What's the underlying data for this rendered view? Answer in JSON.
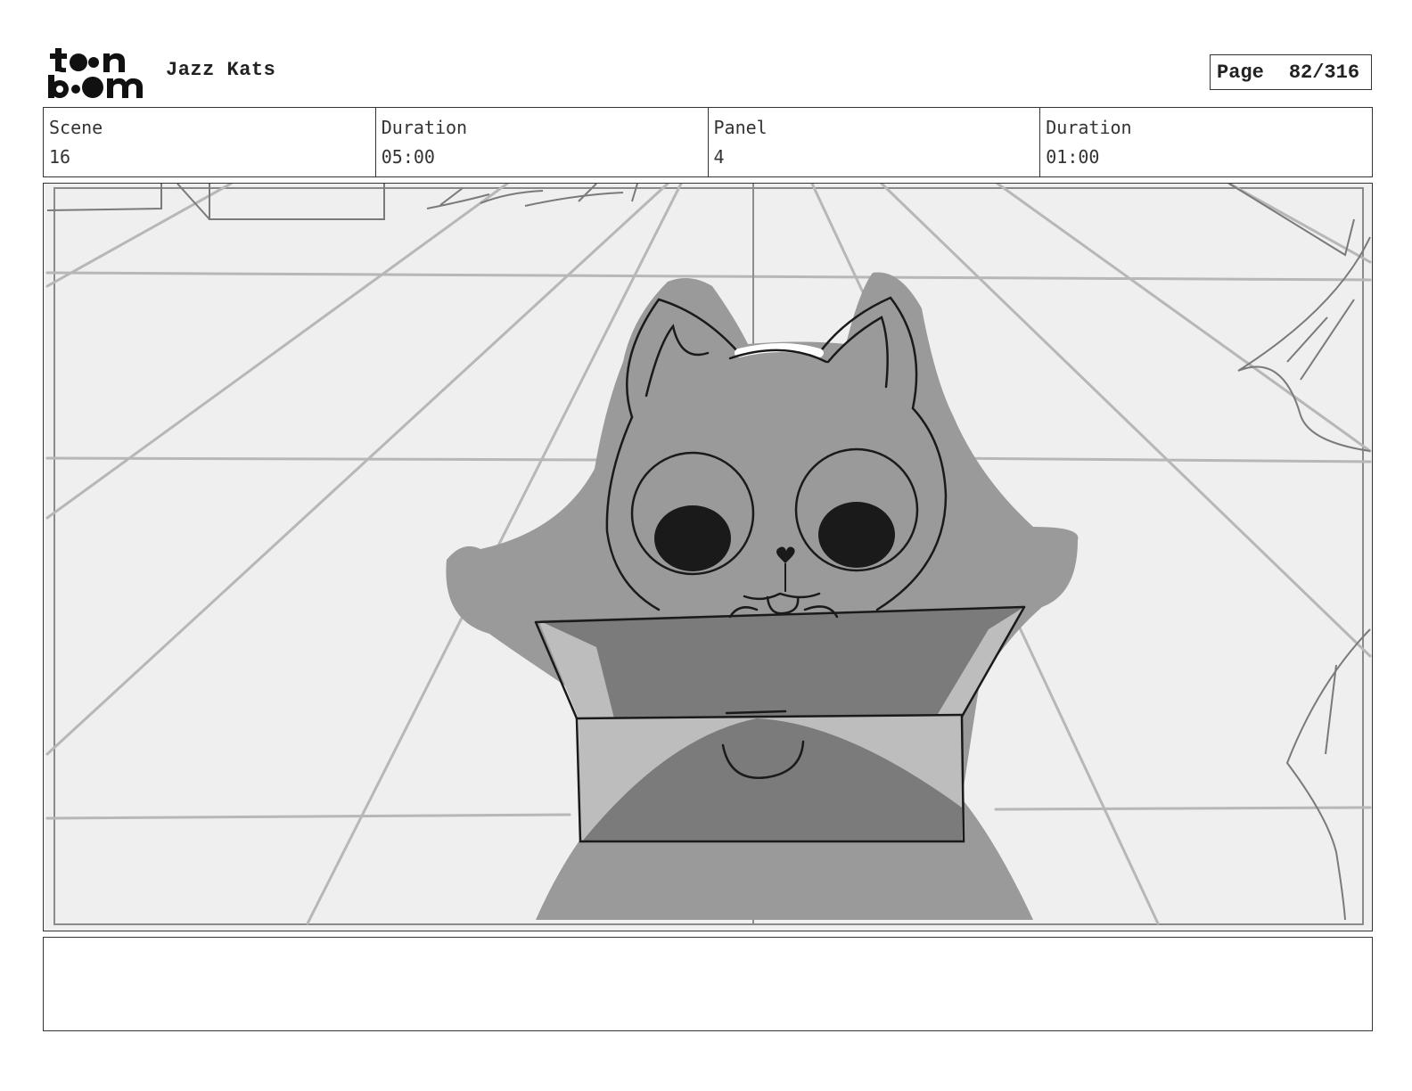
{
  "header": {
    "logo_alt": "toon boom",
    "project_title": "Jazz Kats",
    "page_label": "Page",
    "page_number": "82/316"
  },
  "info": {
    "scene_label": "Scene",
    "scene_value": "16",
    "scene_duration_label": "Duration",
    "scene_duration_value": "05:00",
    "panel_label": "Panel",
    "panel_value": "4",
    "panel_duration_label": "Duration",
    "panel_duration_value": "01:00"
  },
  "notes": {
    "text": ""
  },
  "colors": {
    "frame_border": "#333333",
    "panel_background": "#efefef",
    "cat_fill": "#9a9a9a",
    "box_dark": "#7a7a7a",
    "box_light": "#bdbdbd",
    "eye_fill": "#1a1a1a"
  }
}
